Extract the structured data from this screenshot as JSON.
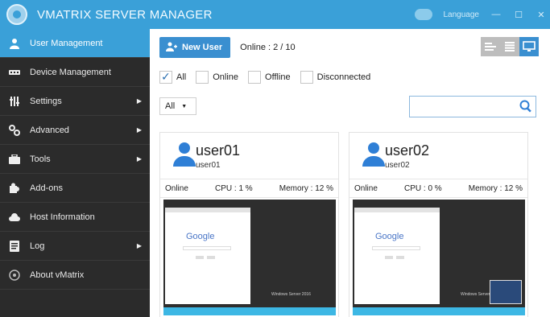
{
  "app": {
    "title": "VMATRIX SERVER MANAGER",
    "language_label": "Language",
    "minimize": "—",
    "maximize": "☐",
    "close": "✕",
    "accent": "#3aa0d8"
  },
  "sidebar": {
    "items": [
      {
        "label": "User Management",
        "icon": "user-icon"
      },
      {
        "label": "Device Management",
        "icon": "device-icon"
      },
      {
        "label": "Settings",
        "icon": "settings-icon"
      },
      {
        "label": "Advanced",
        "icon": "advanced-icon"
      },
      {
        "label": "Tools",
        "icon": "tools-icon"
      },
      {
        "label": "Add-ons",
        "icon": "puzzle-icon"
      },
      {
        "label": "Host Information",
        "icon": "cloud-icon"
      },
      {
        "label": "Log",
        "icon": "log-icon"
      },
      {
        "label": "About vMatrix",
        "icon": "about-icon"
      }
    ]
  },
  "toolbar": {
    "new_user_label": "New User",
    "online_text": "Online : 2 / 10"
  },
  "filters": {
    "all": "All",
    "online": "Online",
    "offline": "Offline",
    "disconnected": "Disconnected"
  },
  "select": {
    "value": "All"
  },
  "search": {
    "placeholder": ""
  },
  "users": [
    {
      "name": "user01",
      "sub": "user01",
      "status": "Online",
      "cpu": "CPU : 1 %",
      "memory": "Memory : 12 %"
    },
    {
      "name": "user02",
      "sub": "user02",
      "status": "Online",
      "cpu": "CPU : 0 %",
      "memory": "Memory : 12 %"
    }
  ],
  "screen": {
    "google": "Google",
    "brand": "Windows Server 2016"
  }
}
